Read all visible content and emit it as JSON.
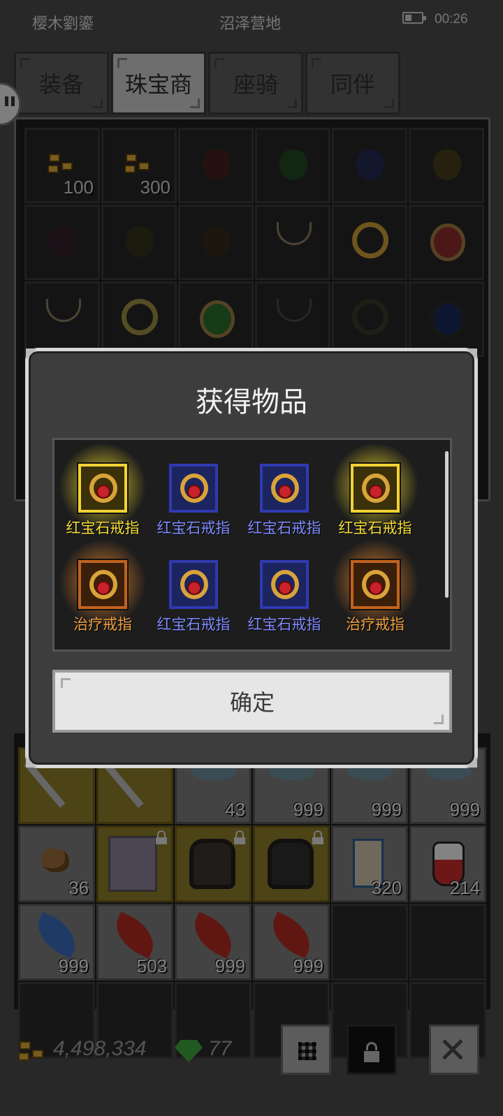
{
  "status_bar": {
    "player_name": "樱木劉鎏",
    "location": "沼泽营地",
    "time": "00:26"
  },
  "tabs": [
    {
      "label": "装备",
      "active": false
    },
    {
      "label": "珠宝商",
      "active": true
    },
    {
      "label": "座骑",
      "active": false
    },
    {
      "label": "同伴",
      "active": false
    }
  ],
  "shop_counts": [
    "100",
    "300"
  ],
  "modal": {
    "title": "获得物品",
    "items": [
      {
        "name": "红宝石戒指",
        "rarity_color": "#f4dc3a"
      },
      {
        "name": "红宝石戒指",
        "rarity_color": "#7f8bff"
      },
      {
        "name": "红宝石戒指",
        "rarity_color": "#7f8bff"
      },
      {
        "name": "红宝石戒指",
        "rarity_color": "#f4dc3a"
      },
      {
        "name": "治疗戒指",
        "rarity_color": "#f0a040"
      },
      {
        "name": "红宝石戒指",
        "rarity_color": "#7f8bff"
      },
      {
        "name": "红宝石戒指",
        "rarity_color": "#7f8bff"
      },
      {
        "name": "治疗戒指",
        "rarity_color": "#f0a040"
      }
    ],
    "confirm_label": "确定"
  },
  "inventory": {
    "row1_counts": [
      "43",
      "999",
      "999",
      "999"
    ],
    "row2_counts": [
      "36",
      "320",
      "214"
    ],
    "row3_counts": [
      "999",
      "503",
      "999",
      "999"
    ]
  },
  "currency": {
    "gold": "4,498,334",
    "gems": "77"
  },
  "colors": {
    "legendary_yellow": "#f4dc3a",
    "rare_blue": "#7f8bff",
    "epic_orange": "#f0a040"
  }
}
